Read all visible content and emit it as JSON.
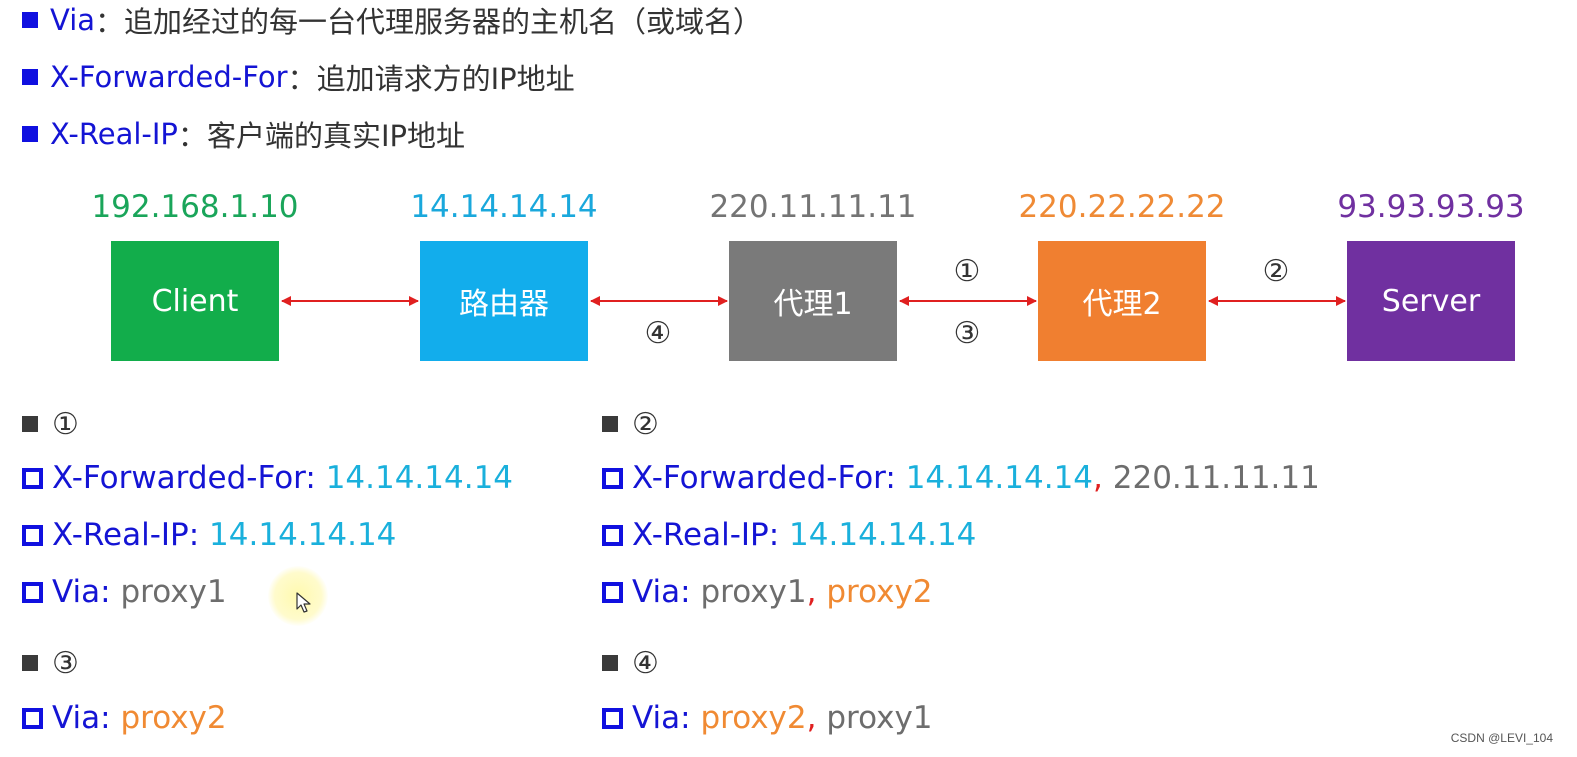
{
  "bullets": [
    {
      "key": "Via",
      "sep": "：",
      "desc": "追加经过的每一台代理服务器的主机名（或域名）"
    },
    {
      "key": "X-Forwarded-For",
      "sep": "：",
      "desc": "追加请求方的IP地址"
    },
    {
      "key": "X-Real-IP",
      "sep": "：",
      "desc": "客户端的真实IP地址"
    }
  ],
  "nodes": [
    {
      "label": "Client",
      "ip": "192.168.1.10",
      "color": "#12ad4b",
      "ip_color": "#1aa55a"
    },
    {
      "label": "路由器",
      "ip": "14.14.14.14",
      "color": "#12adec",
      "ip_color": "#1aa8dc"
    },
    {
      "label": "代理1",
      "ip": "220.11.11.11",
      "color": "#7a7a7a",
      "ip_color": "#747474"
    },
    {
      "label": "代理2",
      "ip": "220.22.22.22",
      "color": "#f07f30",
      "ip_color": "#ef8a35"
    },
    {
      "label": "Server",
      "ip": "93.93.93.93",
      "color": "#7030a0",
      "ip_color": "#7030a0"
    }
  ],
  "diagram_steps": {
    "s1": "①",
    "s2": "②",
    "s3": "③",
    "s4": "④"
  },
  "arrow_color": "#e02020",
  "sections": {
    "s1": {
      "marker": "①",
      "xff_key": "X-Forwarded-For:",
      "xff_val1": "14.14.14.14",
      "real_key": "X-Real-IP:",
      "real_val": "14.14.14.14",
      "via_key": "Via:",
      "via_val1": "proxy1"
    },
    "s2": {
      "marker": "②",
      "xff_key": "X-Forwarded-For:",
      "xff_val1": "14.14.14.14",
      "xff_sep": ",",
      "xff_val2": "220.11.11.11",
      "real_key": "X-Real-IP:",
      "real_val": "14.14.14.14",
      "via_key": "Via:",
      "via_val1": "proxy1",
      "via_sep": ",",
      "via_val2": "proxy2"
    },
    "s3": {
      "marker": "③",
      "via_key": "Via:",
      "via_val1": "proxy2"
    },
    "s4": {
      "marker": "④",
      "via_key": "Via:",
      "via_val1": "proxy2",
      "via_sep": ",",
      "via_val2": "proxy1"
    }
  },
  "watermark": "CSDN @LEVI_104"
}
